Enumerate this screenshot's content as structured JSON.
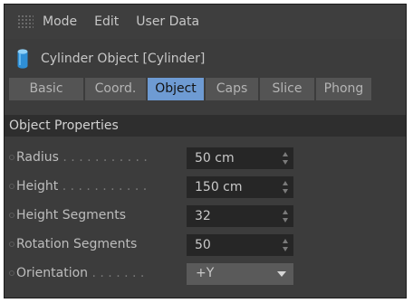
{
  "menubar": {
    "items": [
      "Mode",
      "Edit",
      "User Data"
    ]
  },
  "object": {
    "title": "Cylinder Object [Cylinder]",
    "icon": "cylinder-icon",
    "icon_color": "#4aa8e6"
  },
  "tabs": [
    {
      "label": "Basic",
      "active": false
    },
    {
      "label": "Coord.",
      "active": false
    },
    {
      "label": "Object",
      "active": true
    },
    {
      "label": "Caps",
      "active": false
    },
    {
      "label": "Slice",
      "active": false
    },
    {
      "label": "Phong",
      "active": false
    }
  ],
  "section": {
    "title": "Object Properties"
  },
  "properties": [
    {
      "label": "Radius",
      "dots": " . . . . . . . . . . .",
      "value": "50 cm"
    },
    {
      "label": "Height",
      "dots": " . . . . . . . . . . .",
      "value": "150 cm"
    },
    {
      "label": "Height Segments",
      "dots": "",
      "value": "32"
    },
    {
      "label": "Rotation Segments",
      "dots": "",
      "value": "50"
    }
  ],
  "orientation": {
    "label": "Orientation",
    "dots": " . . . . . . .",
    "value": "+Y"
  },
  "colors": {
    "tab_active": "#6e9bd3",
    "panel_bg": "#3c3c3c",
    "field_bg": "#262626"
  }
}
